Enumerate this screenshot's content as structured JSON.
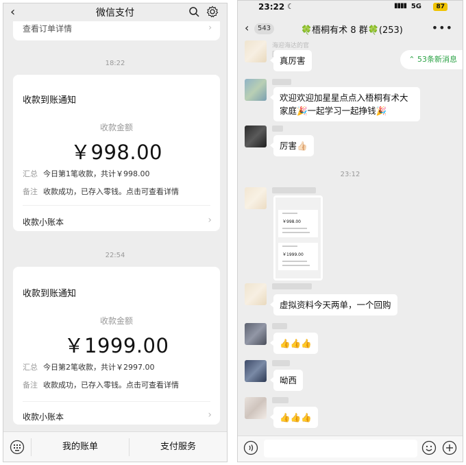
{
  "left": {
    "header_title": "微信支付",
    "stub_text": "查看订单详情",
    "cards": [
      {
        "time": "18:22",
        "title": "收款到账通知",
        "amount_label": "收款金额",
        "amount": "￥998.00",
        "summary_key": "汇总",
        "summary": "今日第1笔收款，共计￥998.00",
        "note_key": "备注",
        "note": "收款成功，已存入零钱。点击可查看详情",
        "footer": "收款小账本"
      },
      {
        "time": "22:54",
        "title": "收款到账通知",
        "amount_label": "收款金额",
        "amount": "￥1999.00",
        "summary_key": "汇总",
        "summary": "今日第2笔收款，共计￥2997.00",
        "note_key": "备注",
        "note": "收款成功，已存入零钱。点击可查看详情",
        "footer": "收款小账本"
      }
    ],
    "tabs": [
      "我的账单",
      "支付服务"
    ]
  },
  "right": {
    "status_time": "23:22",
    "network": "5G",
    "battery": "87",
    "unread_count": "543",
    "group_title": "🍀梧桐有术 8 群🍀(253)",
    "new_messages": "53条新消息",
    "nick_1": "海迎海达的官图",
    "messages": [
      "真厉害",
      "欢迎欢迎加星星点点入梧桐有术大家庭🎉一起学习一起挣钱🎉",
      "厉害👍🏻",
      "虚拟资料今天两单，一个回购",
      "👍👍👍",
      "呦西",
      "👍👍👍"
    ],
    "time_divider": "23:12",
    "shot_amounts": [
      "￥998.00",
      "￥1999.00"
    ]
  },
  "colors": {
    "wechat_green": "#2ba245",
    "battery_yellow": "#f0c400"
  }
}
